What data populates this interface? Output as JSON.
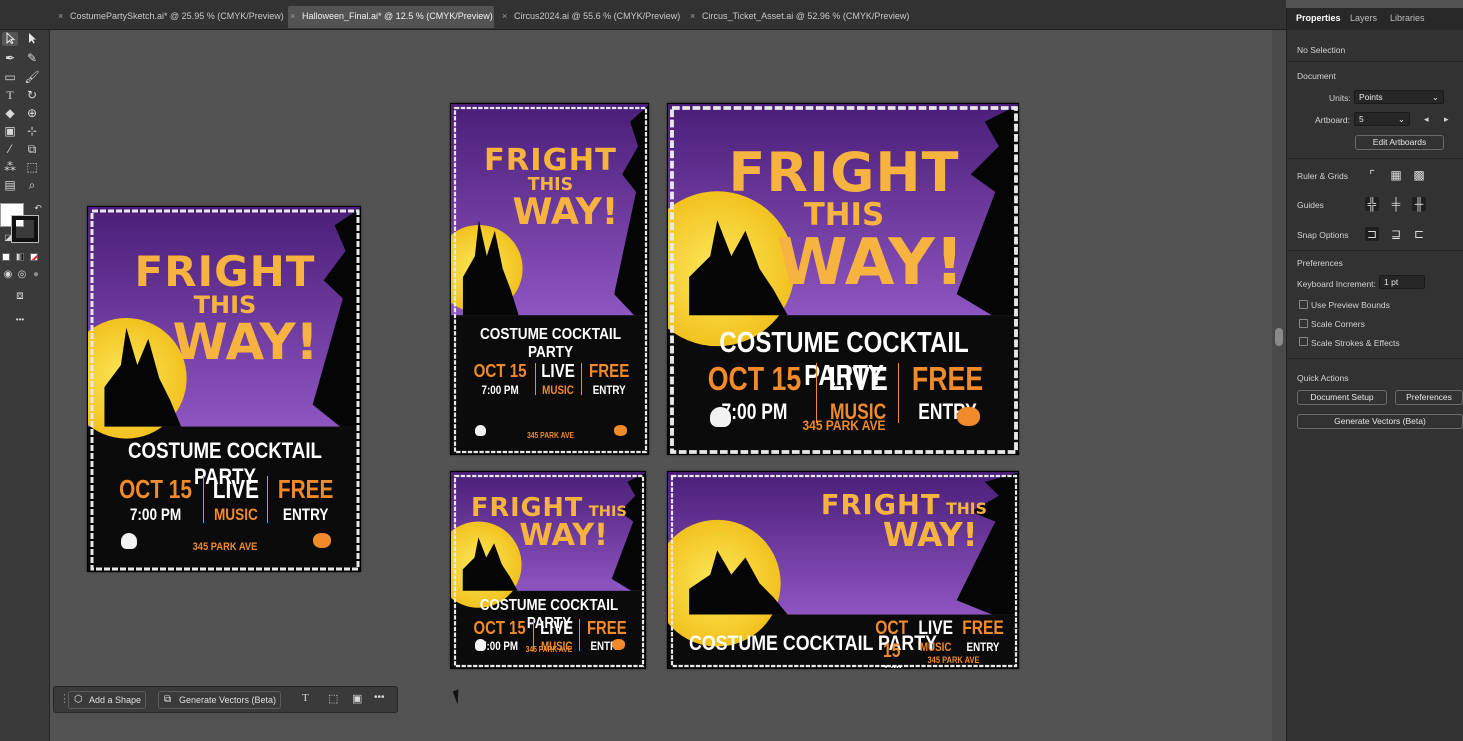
{
  "tabs": [
    {
      "label": "CostumePartySketch.ai* @ 25.95 % (CMYK/Preview)",
      "active": false
    },
    {
      "label": "Halloween_Final.ai* @ 12.5 % (CMYK/Preview)",
      "active": true
    },
    {
      "label": "Circus2024.ai @ 55.6 % (CMYK/Preview)",
      "active": false
    },
    {
      "label": "Circus_Ticket_Asset.ai @ 52.96 % (CMYK/Preview)",
      "active": false
    }
  ],
  "tab_close": "×",
  "panel": {
    "tabs": [
      "Properties",
      "Layers",
      "Libraries"
    ],
    "selection": "No Selection",
    "document_heading": "Document",
    "units_label": "Units:",
    "units_value": "Points",
    "artboard_label": "Artboard:",
    "artboard_value": "5",
    "edit_artboards": "Edit Artboards",
    "ruler_grids": "Ruler & Grids",
    "guides": "Guides",
    "snap_options": "Snap Options",
    "preferences_heading": "Preferences",
    "keyboard_increment_label": "Keyboard Increment:",
    "keyboard_increment_value": "1 pt",
    "use_preview_bounds": "Use Preview Bounds",
    "scale_corners": "Scale Corners",
    "scale_strokes": "Scale Strokes & Effects",
    "quick_actions": "Quick Actions",
    "document_setup": "Document Setup",
    "preferences_btn": "Preferences",
    "generate_vectors": "Generate Vectors (Beta)"
  },
  "context_bar": {
    "add_shape": "Add a Shape",
    "generate_vectors": "Generate Vectors (Beta)"
  },
  "toolbar_more": "•••",
  "poster": {
    "title1": "FRIGHT",
    "title2": "THIS",
    "title3": "WAY!",
    "subtitle": "COSTUME COCKTAIL PARTY",
    "date": "OCT 15",
    "time": "7:00 PM",
    "live": "LIVE",
    "music": "MUSIC",
    "free": "FREE",
    "entry": "ENTRY",
    "address": "345 PARK AVE"
  },
  "colors": {
    "orange": "#f08a2a",
    "purple": "#6a3a9a",
    "moon": "#f4d233"
  }
}
